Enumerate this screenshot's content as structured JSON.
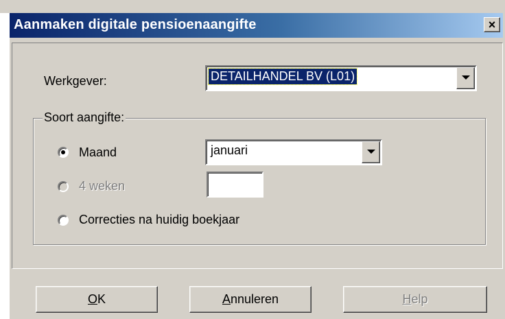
{
  "dialog": {
    "title": "Aanmaken digitale pensioenaangifte",
    "close_label": "×"
  },
  "werkgever": {
    "label": "Werkgever:",
    "value": "DETAILHANDEL BV (L01)"
  },
  "soort": {
    "legend": "Soort aangifte:",
    "options": [
      {
        "label": "Maand",
        "checked": true,
        "enabled": true
      },
      {
        "label": "4 weken",
        "checked": false,
        "enabled": false
      },
      {
        "label": "Correcties na huidig boekjaar",
        "checked": false,
        "enabled": true
      }
    ],
    "maand_value": "januari",
    "weken_value": ""
  },
  "buttons": {
    "ok_first": "O",
    "ok_rest": "K",
    "cancel_first": "A",
    "cancel_rest": "nnuleren",
    "help_first": "H",
    "help_rest": "elp"
  },
  "colors": {
    "title_start": "#0a246a",
    "face": "#d4d0c8",
    "selection": "#0a246a"
  }
}
